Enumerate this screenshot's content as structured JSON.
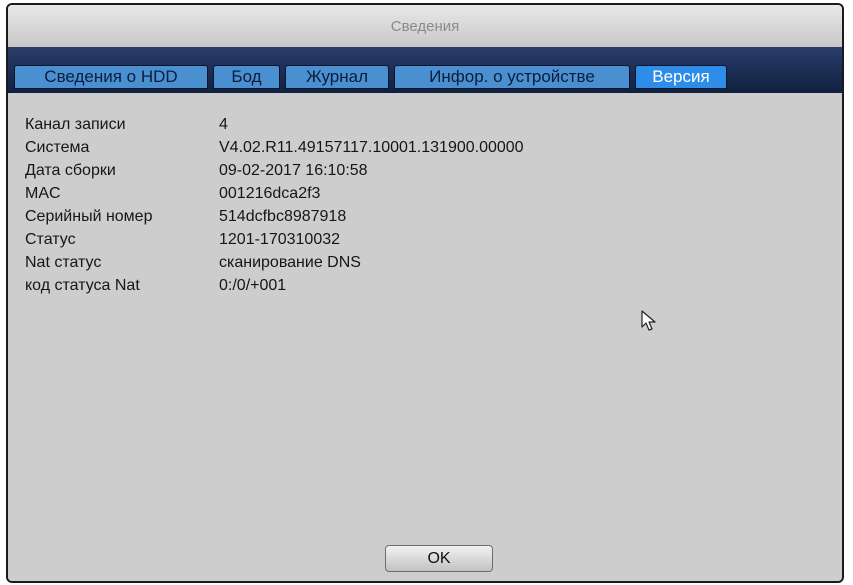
{
  "window": {
    "title": "Сведения"
  },
  "tabs": [
    {
      "label": "Сведения о HDD",
      "active": false
    },
    {
      "label": "Бод",
      "active": false
    },
    {
      "label": "Журнал",
      "active": false
    },
    {
      "label": "Инфор. о устройстве",
      "active": false
    },
    {
      "label": "Версия",
      "active": true
    }
  ],
  "info": [
    {
      "label": "Канал записи",
      "value": "4"
    },
    {
      "label": "Система",
      "value": "V4.02.R11.49157117.10001.131900.00000"
    },
    {
      "label": "Дата сборки",
      "value": "09-02-2017 16:10:58"
    },
    {
      "label": "MAC",
      "value": "001216dca2f3"
    },
    {
      "label": "Серийный номер",
      "value": "514dcfbc8987918"
    },
    {
      "label": "Статус",
      "value": "1201-170310032"
    },
    {
      "label": "Nat статус",
      "value": "сканирование DNS"
    },
    {
      "label": "код статуса Nat",
      "value": "0:/0/+001"
    }
  ],
  "buttons": {
    "ok": "OK"
  },
  "colors": {
    "tab": "#4a90d0",
    "tab_active": "#2e8de8",
    "tab_strip": "#10203f",
    "panel": "#cdcdcd"
  },
  "icons": {
    "cursor": "mouse-pointer-icon"
  }
}
